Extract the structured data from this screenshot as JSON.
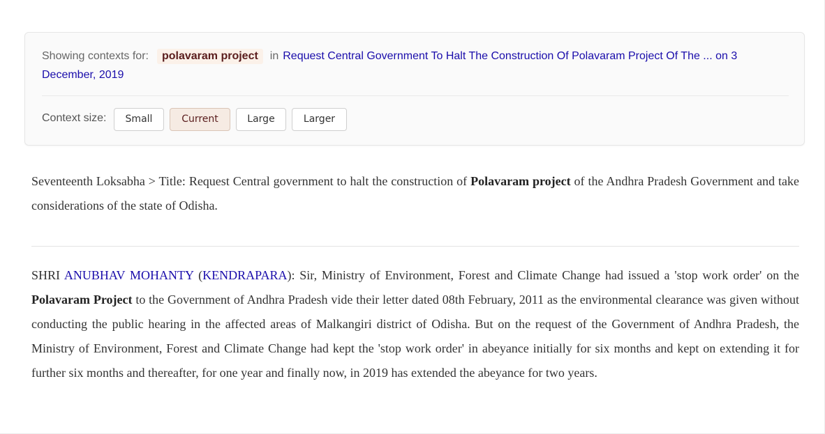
{
  "context": {
    "showing_label": "Showing contexts for:",
    "query": "polavaram project",
    "in_word": "in",
    "doc_title": "Request Central Government To Halt The Construction Of Polavaram Project Of The ... on 3 December, 2019",
    "size_label": "Context size:",
    "sizes": [
      "Small",
      "Current",
      "Large",
      "Larger"
    ],
    "selected_size": "Current"
  },
  "paragraph1": {
    "prefix": "Seventeenth Loksabha > Title: Request Central government to halt the construction of ",
    "bold": "Polavaram project",
    "suffix": " of the Andhra Pradesh Government and take considerations of the state of Odisha."
  },
  "paragraph2": {
    "speaker_prefix": "SHRI ",
    "speaker_name": "ANUBHAV MOHANTY",
    "open_paren": " (",
    "constituency": "KENDRAPARA",
    "text1": "): Sir, Ministry of Environment, Forest and Climate Change had issued a 'stop work order' on the ",
    "bold": "Polavaram Project",
    "text2": " to the Government of Andhra Pradesh vide their letter dated 08th February, 2011 as the environmental clearance was given without conducting the public hearing in the affected areas of Malkangiri district of Odisha. But on the request of the Government of Andhra Pradesh, the Ministry of Environment, Forest and Climate Change had kept the 'stop work order' in abeyance initially for six months and kept on extending it for further six months and thereafter, for one year and finally now, in 2019 has extended the abeyance for two years."
  }
}
